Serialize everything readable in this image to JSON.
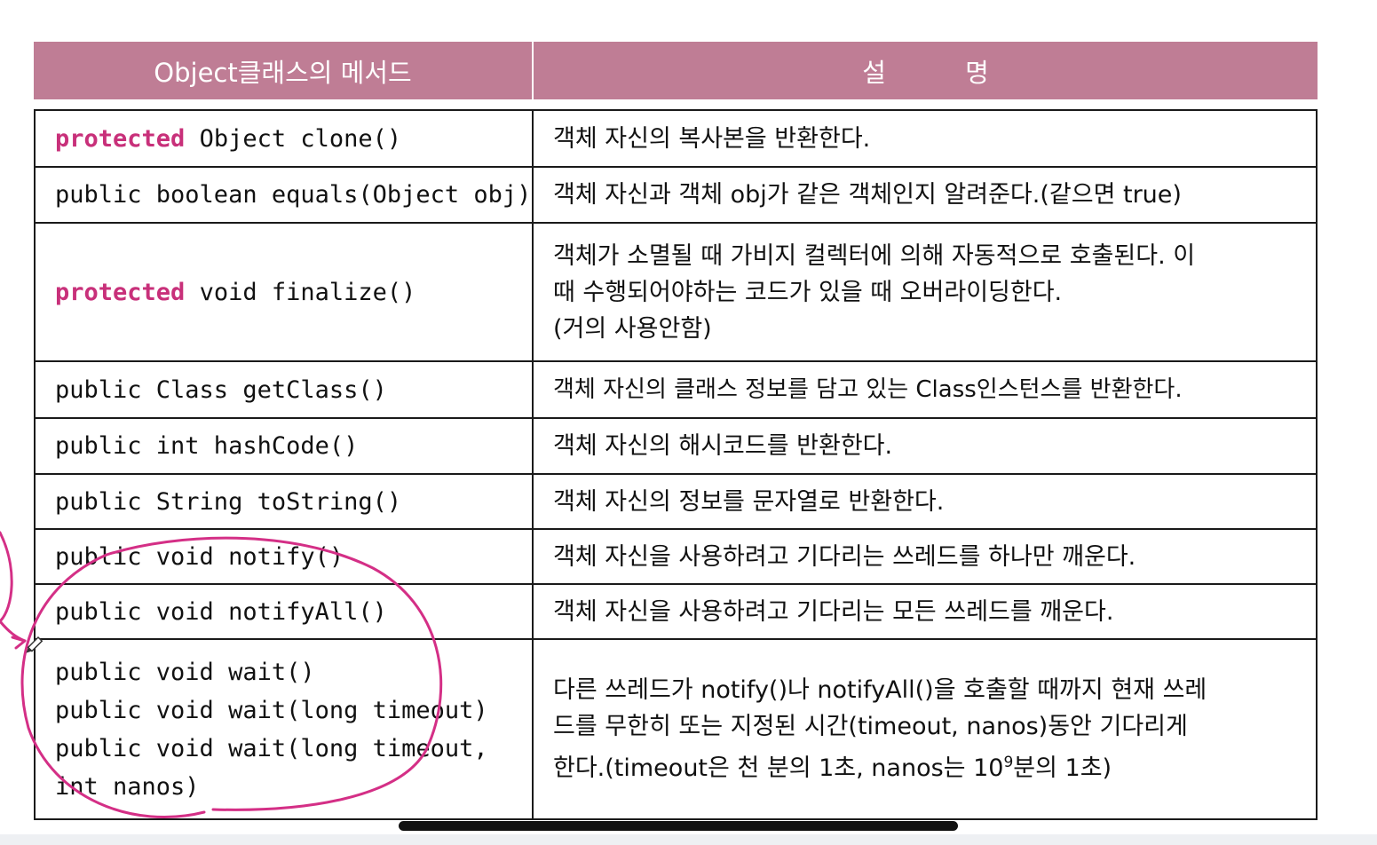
{
  "table": {
    "header": {
      "method": "Object클래스의 메서드",
      "description": "설 명"
    },
    "rows": [
      {
        "keyword": "protected",
        "signature": " Object clone()",
        "description": "객체 자신의 복사본을 반환한다."
      },
      {
        "keyword": "",
        "signature": "public boolean equals(Object obj)",
        "description": "객체 자신과 객체 obj가 같은 객체인지 알려준다.(같으면 true)"
      },
      {
        "keyword": "protected",
        "signature": " void finalize()",
        "description_lines": [
          "객체가 소멸될 때 가비지 컬렉터에 의해 자동적으로 호출된다. 이",
          "때 수행되어야하는 코드가 있을 때 오버라이딩한다.",
          "(거의 사용안함)"
        ]
      },
      {
        "keyword": "",
        "signature": "public Class getClass()",
        "description": "객체 자신의 클래스 정보를 담고 있는 Class인스턴스를 반환한다."
      },
      {
        "keyword": "",
        "signature": "public int hashCode()",
        "description": "객체 자신의 해시코드를 반환한다."
      },
      {
        "keyword": "",
        "signature": "public String toString()",
        "description": "객체 자신의 정보를 문자열로 반환한다."
      },
      {
        "keyword": "",
        "signature": "public void notify()",
        "description": "객체 자신을 사용하려고 기다리는 쓰레드를 하나만 깨운다."
      },
      {
        "keyword": "",
        "signature": "public void notifyAll()",
        "description": "객체 자신을 사용하려고 기다리는 모든 쓰레드를 깨운다."
      },
      {
        "signature_lines": [
          "public void wait()",
          "public void wait(long timeout)",
          "public void wait(long timeout,",
          "int nanos)"
        ],
        "description_lines": [
          "다른 쓰레드가 notify()나 notifyAll()을 호출할 때까지 현재 쓰레",
          "드를 무한히 또는 지정된 시간(timeout, nanos)동안 기다리게",
          "한다.(timeout은 천 분의 1초, nanos는 10"
        ],
        "superscript": "9",
        "description_tail": "분의 1초)"
      }
    ]
  },
  "colors": {
    "header_bg": "#bf7d95",
    "keyword": "#c8307a",
    "annotation": "#d42f86"
  },
  "icons": {
    "cursor": "pen-cursor-icon"
  }
}
